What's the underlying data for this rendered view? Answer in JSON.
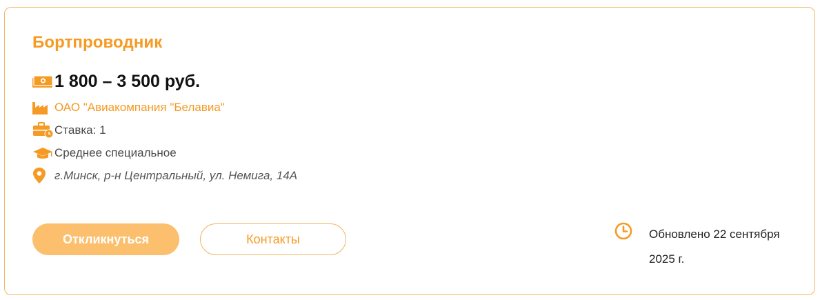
{
  "vacancy": {
    "title": "Бортпроводник",
    "salary": "1 800 – 3 500 руб.",
    "company": "ОАО \"Авиакомпания \"Белавиа\"",
    "rate": "Ставка: 1",
    "education": "Среднее специальное",
    "address": "г.Минск, р-н Центральный, ул. Немига, 14А"
  },
  "actions": {
    "apply_label": "Откликнуться",
    "contacts_label": "Контакты"
  },
  "updated": {
    "text": "Обновлено 22 сентября 2025 г."
  },
  "icons": {
    "salary": "money-icon",
    "company": "factory-icon",
    "rate": "briefcase-clock-icon",
    "education": "graduation-cap-icon",
    "address": "map-pin-icon",
    "updated": "clock-icon"
  },
  "colors": {
    "accent": "#f59a23",
    "border": "#f1b765",
    "apply_button_bg": "#fbbf6e"
  }
}
